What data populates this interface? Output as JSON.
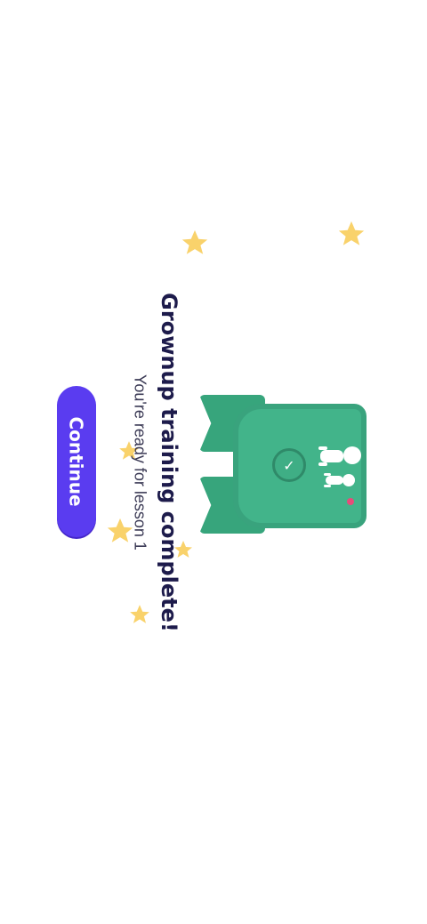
{
  "completion": {
    "title": "Grownup training complete!",
    "subtitle": "You're ready for lesson 1"
  },
  "actions": {
    "continue_label": "Continue"
  },
  "badge": {
    "icon": "check-icon",
    "illustration": "grownup-and-child-icon"
  },
  "colors": {
    "accent": "#5a3cf0",
    "badge_green": "#42b48a",
    "star_yellow": "#f9d26b",
    "title_text": "#1d1b4b"
  }
}
